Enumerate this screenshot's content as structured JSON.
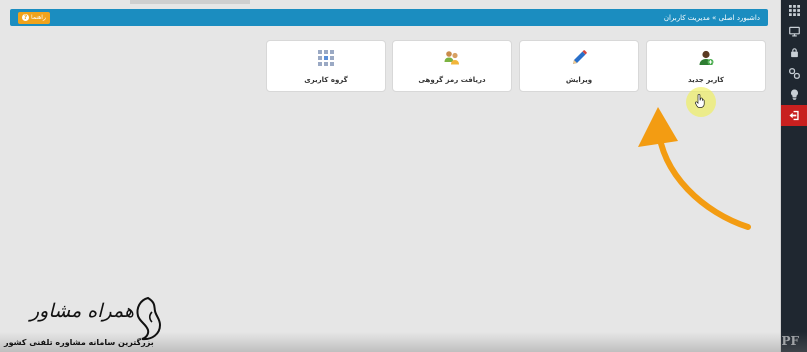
{
  "header": {
    "breadcrumb": "داشبورد اصلی » مدیریت کاربران",
    "help_label": "راهنما",
    "color": "#1b8dc0"
  },
  "tiles": [
    {
      "label": "کاربر جدید",
      "icon": "user-add-icon"
    },
    {
      "label": "ویرایش",
      "icon": "pencil-icon"
    },
    {
      "label": "دریافت رمز گروهی",
      "icon": "users-key-icon"
    },
    {
      "label": "گروه کاربری",
      "icon": "grid-icon"
    }
  ],
  "sidebar": {
    "items": [
      {
        "icon": "apps-grid-icon"
      },
      {
        "icon": "monitor-icon"
      },
      {
        "icon": "lock-icon"
      },
      {
        "icon": "link-icon"
      },
      {
        "icon": "lightbulb-icon"
      },
      {
        "icon": "logout-icon",
        "active": true
      }
    ],
    "active_color": "#c8201f"
  },
  "logo": {
    "title": "همراه مشاور",
    "subtitle": "بزرگترین سامانه مشاوره تلفنی کشور"
  },
  "watermark": "PF",
  "accent_colors": {
    "help_button": "#f0a31c",
    "arrow": "#f39c12"
  }
}
